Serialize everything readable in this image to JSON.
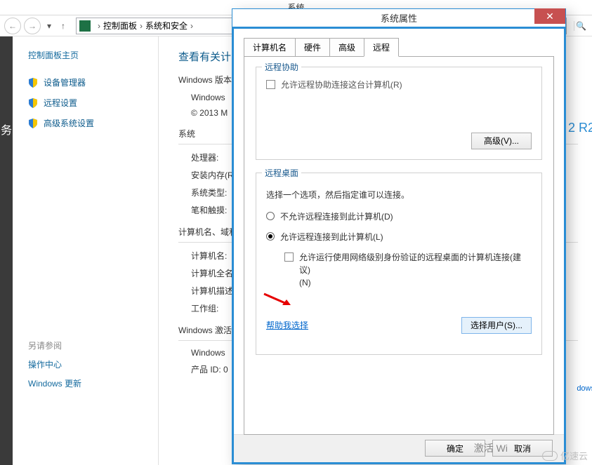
{
  "parent_window": {
    "title": "系统",
    "search_icon_peek": "🔍"
  },
  "breadcrumbs": {
    "root": "控制面板",
    "level1": "系统和安全",
    "sep": "›"
  },
  "left_strip": "务",
  "left_pane": {
    "home": "控制面板主页",
    "links": [
      {
        "label": "设备管理器",
        "icon": "shield-icon"
      },
      {
        "label": "远程设置",
        "icon": "shield-icon"
      },
      {
        "label": "高级系统设置",
        "icon": "shield-icon"
      }
    ],
    "see_also_header": "另请参阅",
    "see_also": [
      "操作中心",
      "Windows 更新"
    ]
  },
  "main_pane": {
    "title": "查看有关计",
    "edition_head": "Windows 版本",
    "edition_line1": "Windows",
    "edition_line2": "© 2013 M",
    "system_head": "系统",
    "system_rows": {
      "cpu": "处理器:",
      "ram": "安装内存(R",
      "type": "系统类型:",
      "pen": "笔和触摸:"
    },
    "name_head": "计算机名、域和",
    "name_rows": {
      "name": "计算机名:",
      "full": "计算机全名",
      "desc": "计算机描述",
      "wg": "工作组:"
    },
    "activation_head": "Windows 激活",
    "activation_rows": {
      "line1": "Windows",
      "pid": "产品 ID: 0"
    },
    "r2_badge": "2 R2",
    "windows_more": "dows "
  },
  "dialog": {
    "title": "系统属性",
    "tabs": {
      "computer_name": "计算机名",
      "hardware": "硬件",
      "advanced": "高级",
      "remote": "远程"
    },
    "remote_assist": {
      "group_title": "远程协助",
      "checkbox_label": "允许远程协助连接这台计算机(R)",
      "advanced_btn": "高级(V)..."
    },
    "remote_desktop": {
      "group_title": "远程桌面",
      "instruction": "选择一个选项，然后指定谁可以连接。",
      "opt_disallow": "不允许远程连接到此计算机(D)",
      "opt_allow": "允许远程连接到此计算机(L)",
      "nla_checkbox": "允许运行使用网络级别身份验证的远程桌面的计算机连接(建议)",
      "nla_suffix": "(N)",
      "help_link": "帮助我选择",
      "select_users_btn": "选择用户(S)..."
    },
    "footer": {
      "ok": "确定",
      "cancel": "取消"
    }
  },
  "watermark": {
    "activate_hint": "激活 Wi",
    "brand": "亿速云"
  }
}
